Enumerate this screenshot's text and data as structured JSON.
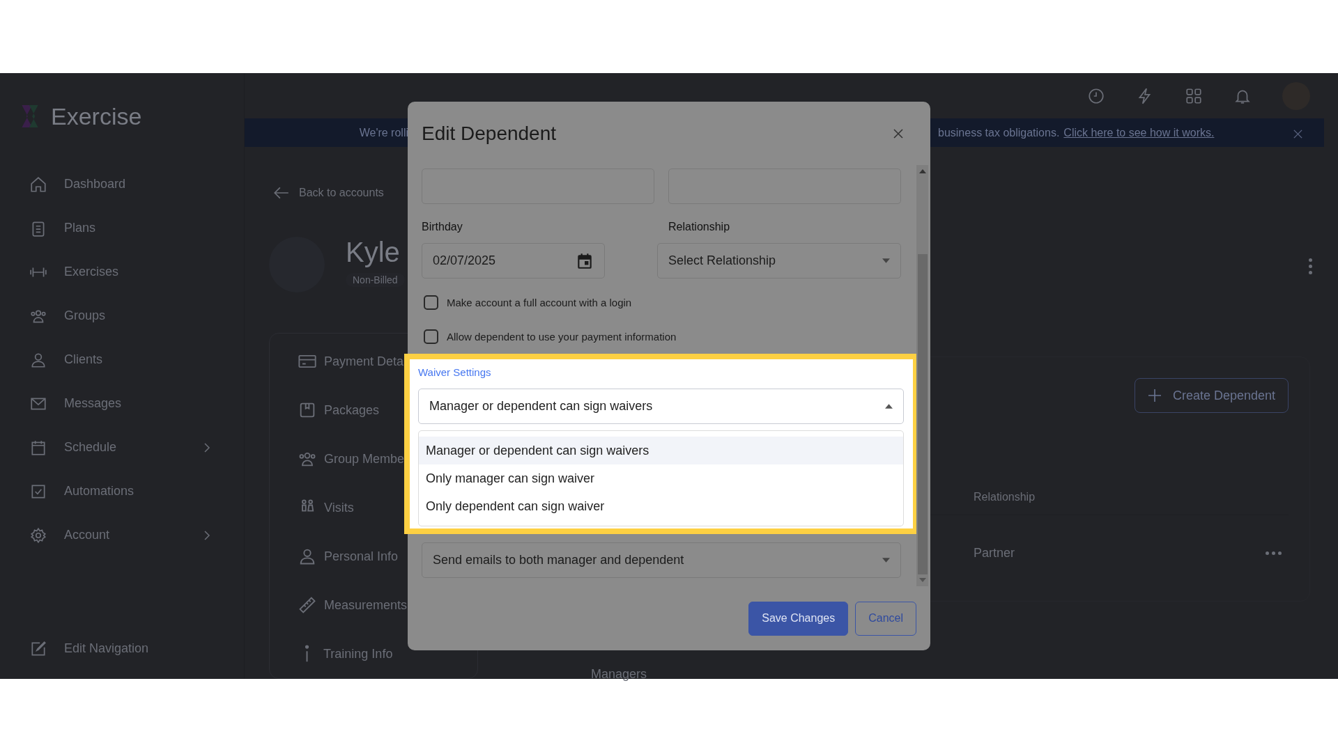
{
  "app": {
    "logo": "Exercise"
  },
  "sidebar": {
    "items": [
      {
        "label": "Dashboard",
        "has_submenu": false
      },
      {
        "label": "Plans",
        "has_submenu": false
      },
      {
        "label": "Exercises",
        "has_submenu": false
      },
      {
        "label": "Groups",
        "has_submenu": false
      },
      {
        "label": "Clients",
        "has_submenu": false
      },
      {
        "label": "Messages",
        "has_submenu": false
      },
      {
        "label": "Schedule",
        "has_submenu": true
      },
      {
        "label": "Automations",
        "has_submenu": false
      },
      {
        "label": "Account",
        "has_submenu": true
      }
    ],
    "footer": "Edit Navigation"
  },
  "banner": {
    "text_left": "We're rolli",
    "text_right": "business tax obligations.",
    "link": "Click here to see how it works."
  },
  "profile": {
    "back": "Back to accounts",
    "name": "Kyle",
    "badge": "Non-Billed",
    "menu": [
      "Payment Deta",
      "Packages",
      "Group Membe",
      "Visits",
      "Personal Info",
      "Measurements",
      "Training Info"
    ]
  },
  "dependents": {
    "create_button": "Create Dependent",
    "columns": [
      "Relationship"
    ],
    "rows": [
      {
        "relationship": "Partner"
      }
    ],
    "next_section": "Managers"
  },
  "modal": {
    "title": "Edit Dependent",
    "birthday": {
      "label": "Birthday",
      "value": "02/07/2025"
    },
    "relationship": {
      "label": "Relationship",
      "placeholder": "Select Relationship"
    },
    "checkboxes": [
      {
        "label": "Make account a full account with a login",
        "checked": false
      },
      {
        "label": "Allow dependent to use your payment information",
        "checked": false
      }
    ],
    "waiver": {
      "label": "Waiver Settings",
      "value": "Manager or dependent can sign waivers",
      "expanded": true,
      "options": [
        {
          "label": "Manager or dependent can sign waivers",
          "selected": true
        },
        {
          "label": "Only manager can sign waiver",
          "selected": false
        },
        {
          "label": "Only dependent can sign waiver",
          "selected": false
        }
      ]
    },
    "email": {
      "value": "Send emails to both manager and dependent"
    },
    "buttons": [
      {
        "label": "Save Changes",
        "kind": "primary"
      },
      {
        "label": "Cancel",
        "kind": "secondary"
      }
    ]
  }
}
